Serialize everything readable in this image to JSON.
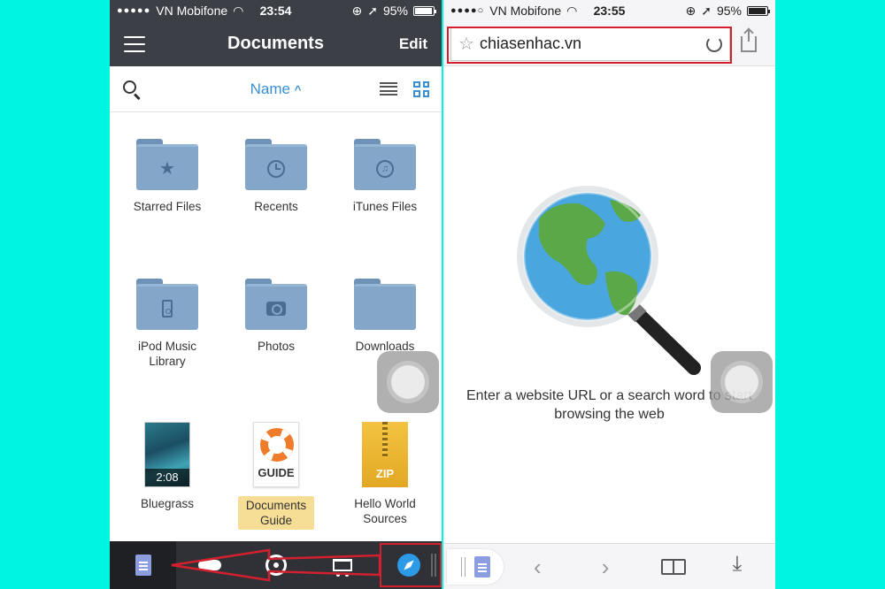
{
  "colors": {
    "background": "#00f5e0",
    "accent": "#3a8fd3",
    "header": "#3d3f46",
    "annotation": "#d3202f"
  },
  "left": {
    "status": {
      "carrier": "VN Mobifone",
      "time": "23:54",
      "battery": "95%",
      "battery_level": 0.95
    },
    "nav": {
      "title": "Documents",
      "edit_label": "Edit"
    },
    "toolbar": {
      "sort_label": "Name",
      "sort_indicator": "^"
    },
    "items": [
      {
        "label": "Starred Files",
        "icon": "star-icon"
      },
      {
        "label": "Recents",
        "icon": "clock-icon"
      },
      {
        "label": "iTunes Files",
        "icon": "music-note-icon"
      },
      {
        "label": "iPod Music Library",
        "icon": "ipod-icon"
      },
      {
        "label": "Photos",
        "icon": "camera-icon"
      },
      {
        "label": "Downloads",
        "icon": "folder-icon"
      },
      {
        "label": "Bluegrass",
        "icon": "video-thumbnail",
        "duration": "2:08"
      },
      {
        "label": "Documents Guide",
        "icon": "lifebuoy-icon",
        "caption": "GUIDE",
        "selected": true
      },
      {
        "label": "Hello World Sources",
        "icon": "zip-icon",
        "caption": "ZIP"
      }
    ],
    "tabbar": [
      "documents-tab",
      "cloud-tab",
      "wifi-tab",
      "store-tab",
      "browser-tab"
    ]
  },
  "right": {
    "status": {
      "carrier": "VN Mobifone",
      "time": "23:55",
      "battery": "95%",
      "battery_level": 0.95
    },
    "address": {
      "url": "chiasenhac.vn"
    },
    "empty_message": "Enter a website URL or a search word to start browsing the web",
    "tabbar": [
      "back-button",
      "forward-button",
      "bookmarks-button",
      "downloads-button"
    ]
  }
}
